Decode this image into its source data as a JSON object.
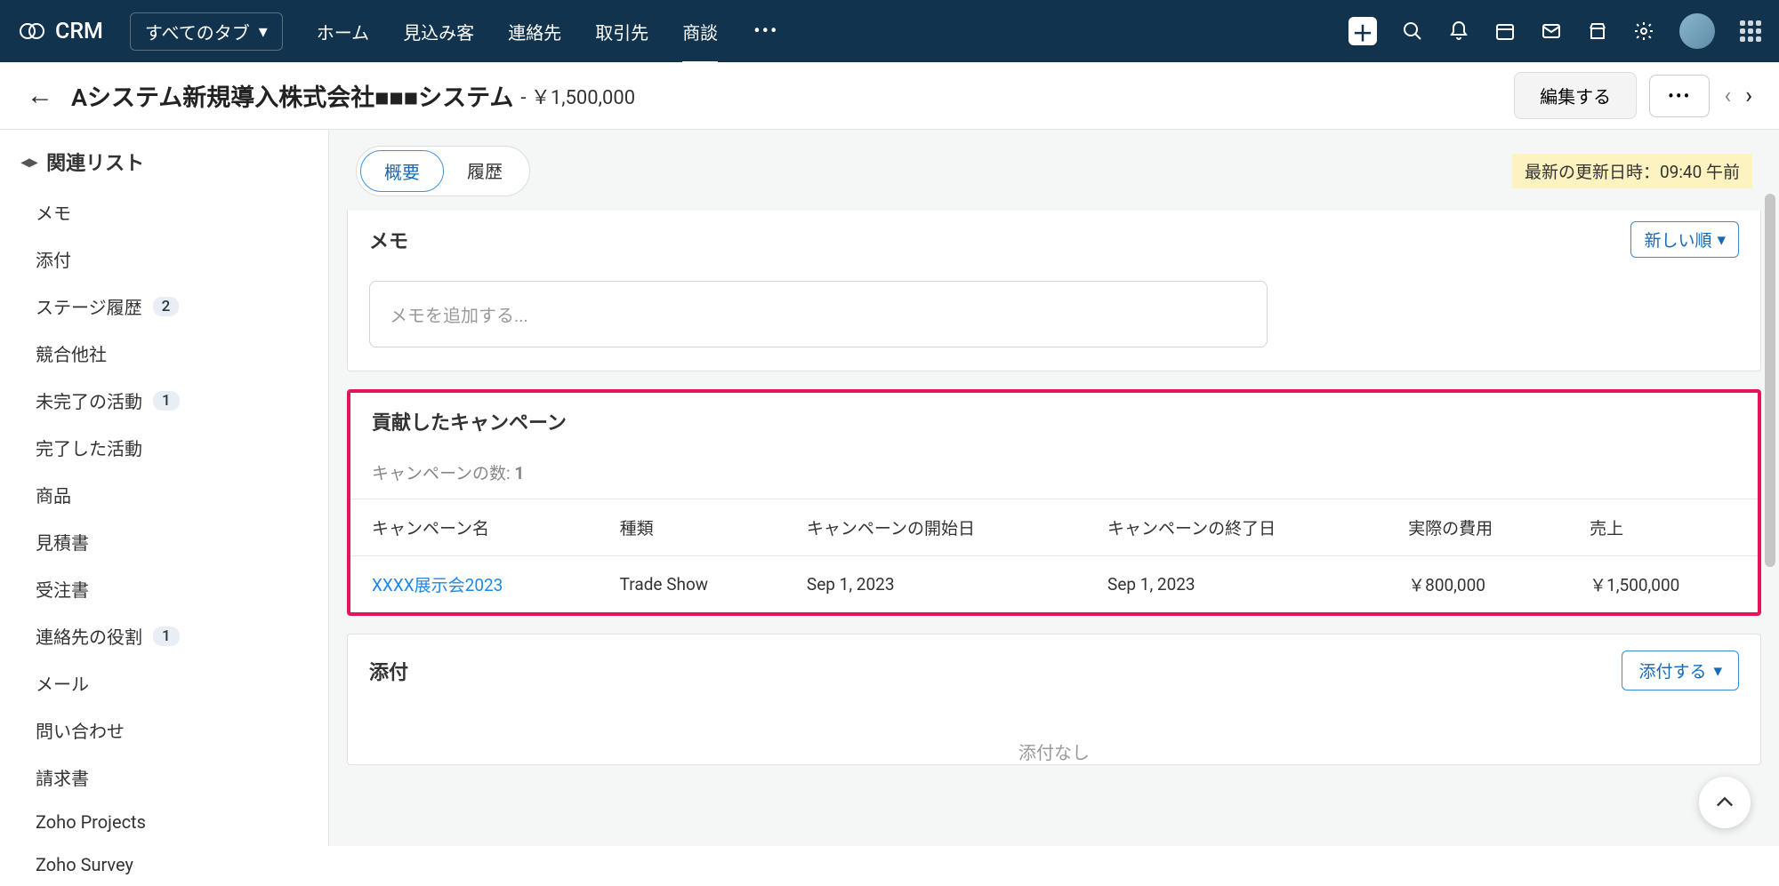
{
  "app": {
    "name": "CRM",
    "tabs_dropdown_label": "すべてのタブ"
  },
  "nav": {
    "tabs": [
      {
        "label": "ホーム",
        "active": false
      },
      {
        "label": "見込み客",
        "active": false
      },
      {
        "label": "連絡先",
        "active": false
      },
      {
        "label": "取引先",
        "active": false
      },
      {
        "label": "商談",
        "active": true
      }
    ]
  },
  "record": {
    "title": "Aシステム新規導入株式会社■■■システム",
    "amount_label": "- ￥1,500,000",
    "edit_label": "編集する"
  },
  "sidebar": {
    "header": "関連リスト",
    "items": [
      {
        "label": "メモ"
      },
      {
        "label": "添付"
      },
      {
        "label": "ステージ履歴",
        "badge": "2"
      },
      {
        "label": "競合他社"
      },
      {
        "label": "未完了の活動",
        "badge": "1"
      },
      {
        "label": "完了した活動"
      },
      {
        "label": "商品"
      },
      {
        "label": "見積書"
      },
      {
        "label": "受注書"
      },
      {
        "label": "連絡先の役割",
        "badge": "1"
      },
      {
        "label": "メール"
      },
      {
        "label": "問い合わせ"
      },
      {
        "label": "請求書"
      },
      {
        "label": "Zoho Projects"
      },
      {
        "label": "Zoho Survey"
      }
    ]
  },
  "content": {
    "pills": {
      "overview": "概要",
      "history": "履歴"
    },
    "last_updated": "最新の更新日時：09:40 午前",
    "memo": {
      "title": "メモ",
      "sort_label": "新しい順",
      "placeholder": "メモを追加する..."
    },
    "campaigns": {
      "title": "貢献したキャンペーン",
      "count_label": "キャンペーンの数:",
      "count_value": "1",
      "columns": [
        "キャンペーン名",
        "種類",
        "キャンペーンの開始日",
        "キャンペーンの終了日",
        "実際の費用",
        "売上"
      ],
      "rows": [
        {
          "name": "XXXX展示会2023",
          "type": "Trade Show",
          "start": "Sep 1, 2023",
          "end": "Sep 1, 2023",
          "cost": "￥800,000",
          "revenue": "￥1,500,000"
        }
      ]
    },
    "attachments": {
      "title": "添付",
      "button": "添付する",
      "empty": "添付なし"
    }
  }
}
